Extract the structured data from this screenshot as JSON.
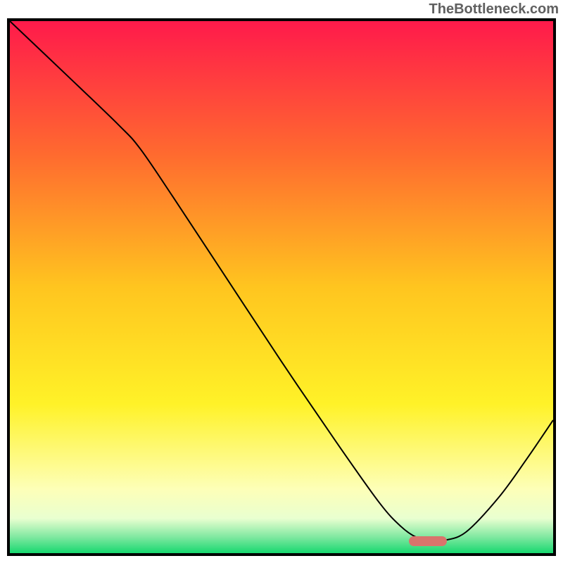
{
  "watermark": "TheBottleneck.com",
  "chart_data": {
    "type": "line",
    "title": "",
    "xlabel": "",
    "ylabel": "",
    "xlim": [
      0,
      100
    ],
    "ylim": [
      0,
      100
    ],
    "grid": false,
    "legend": false,
    "background_gradient": {
      "stops": [
        {
          "offset": 0.0,
          "color": "#ff1a4b"
        },
        {
          "offset": 0.25,
          "color": "#ff6a2f"
        },
        {
          "offset": 0.5,
          "color": "#ffc51f"
        },
        {
          "offset": 0.72,
          "color": "#fff228"
        },
        {
          "offset": 0.88,
          "color": "#fdffb8"
        },
        {
          "offset": 0.935,
          "color": "#e9ffd0"
        },
        {
          "offset": 0.97,
          "color": "#7fe8a0"
        },
        {
          "offset": 1.0,
          "color": "#17d86f"
        }
      ]
    },
    "curve": {
      "description": "Bottleneck curve descending from top-left, flattening near bottom around x≈78, then rising toward the right edge.",
      "points_xy": [
        [
          0,
          100
        ],
        [
          10,
          90.3
        ],
        [
          20,
          80.5
        ],
        [
          24,
          76
        ],
        [
          30,
          67
        ],
        [
          40,
          51.5
        ],
        [
          50,
          36
        ],
        [
          60,
          21
        ],
        [
          68,
          9.5
        ],
        [
          72,
          5
        ],
        [
          75,
          2.9
        ],
        [
          78,
          2.3
        ],
        [
          80,
          2.4
        ],
        [
          84,
          4
        ],
        [
          90,
          10.5
        ],
        [
          95,
          17.5
        ],
        [
          100,
          25
        ]
      ]
    },
    "marker": {
      "x_start": 73.5,
      "x_end": 80.5,
      "y": 2.2,
      "color": "#d9746c"
    }
  }
}
